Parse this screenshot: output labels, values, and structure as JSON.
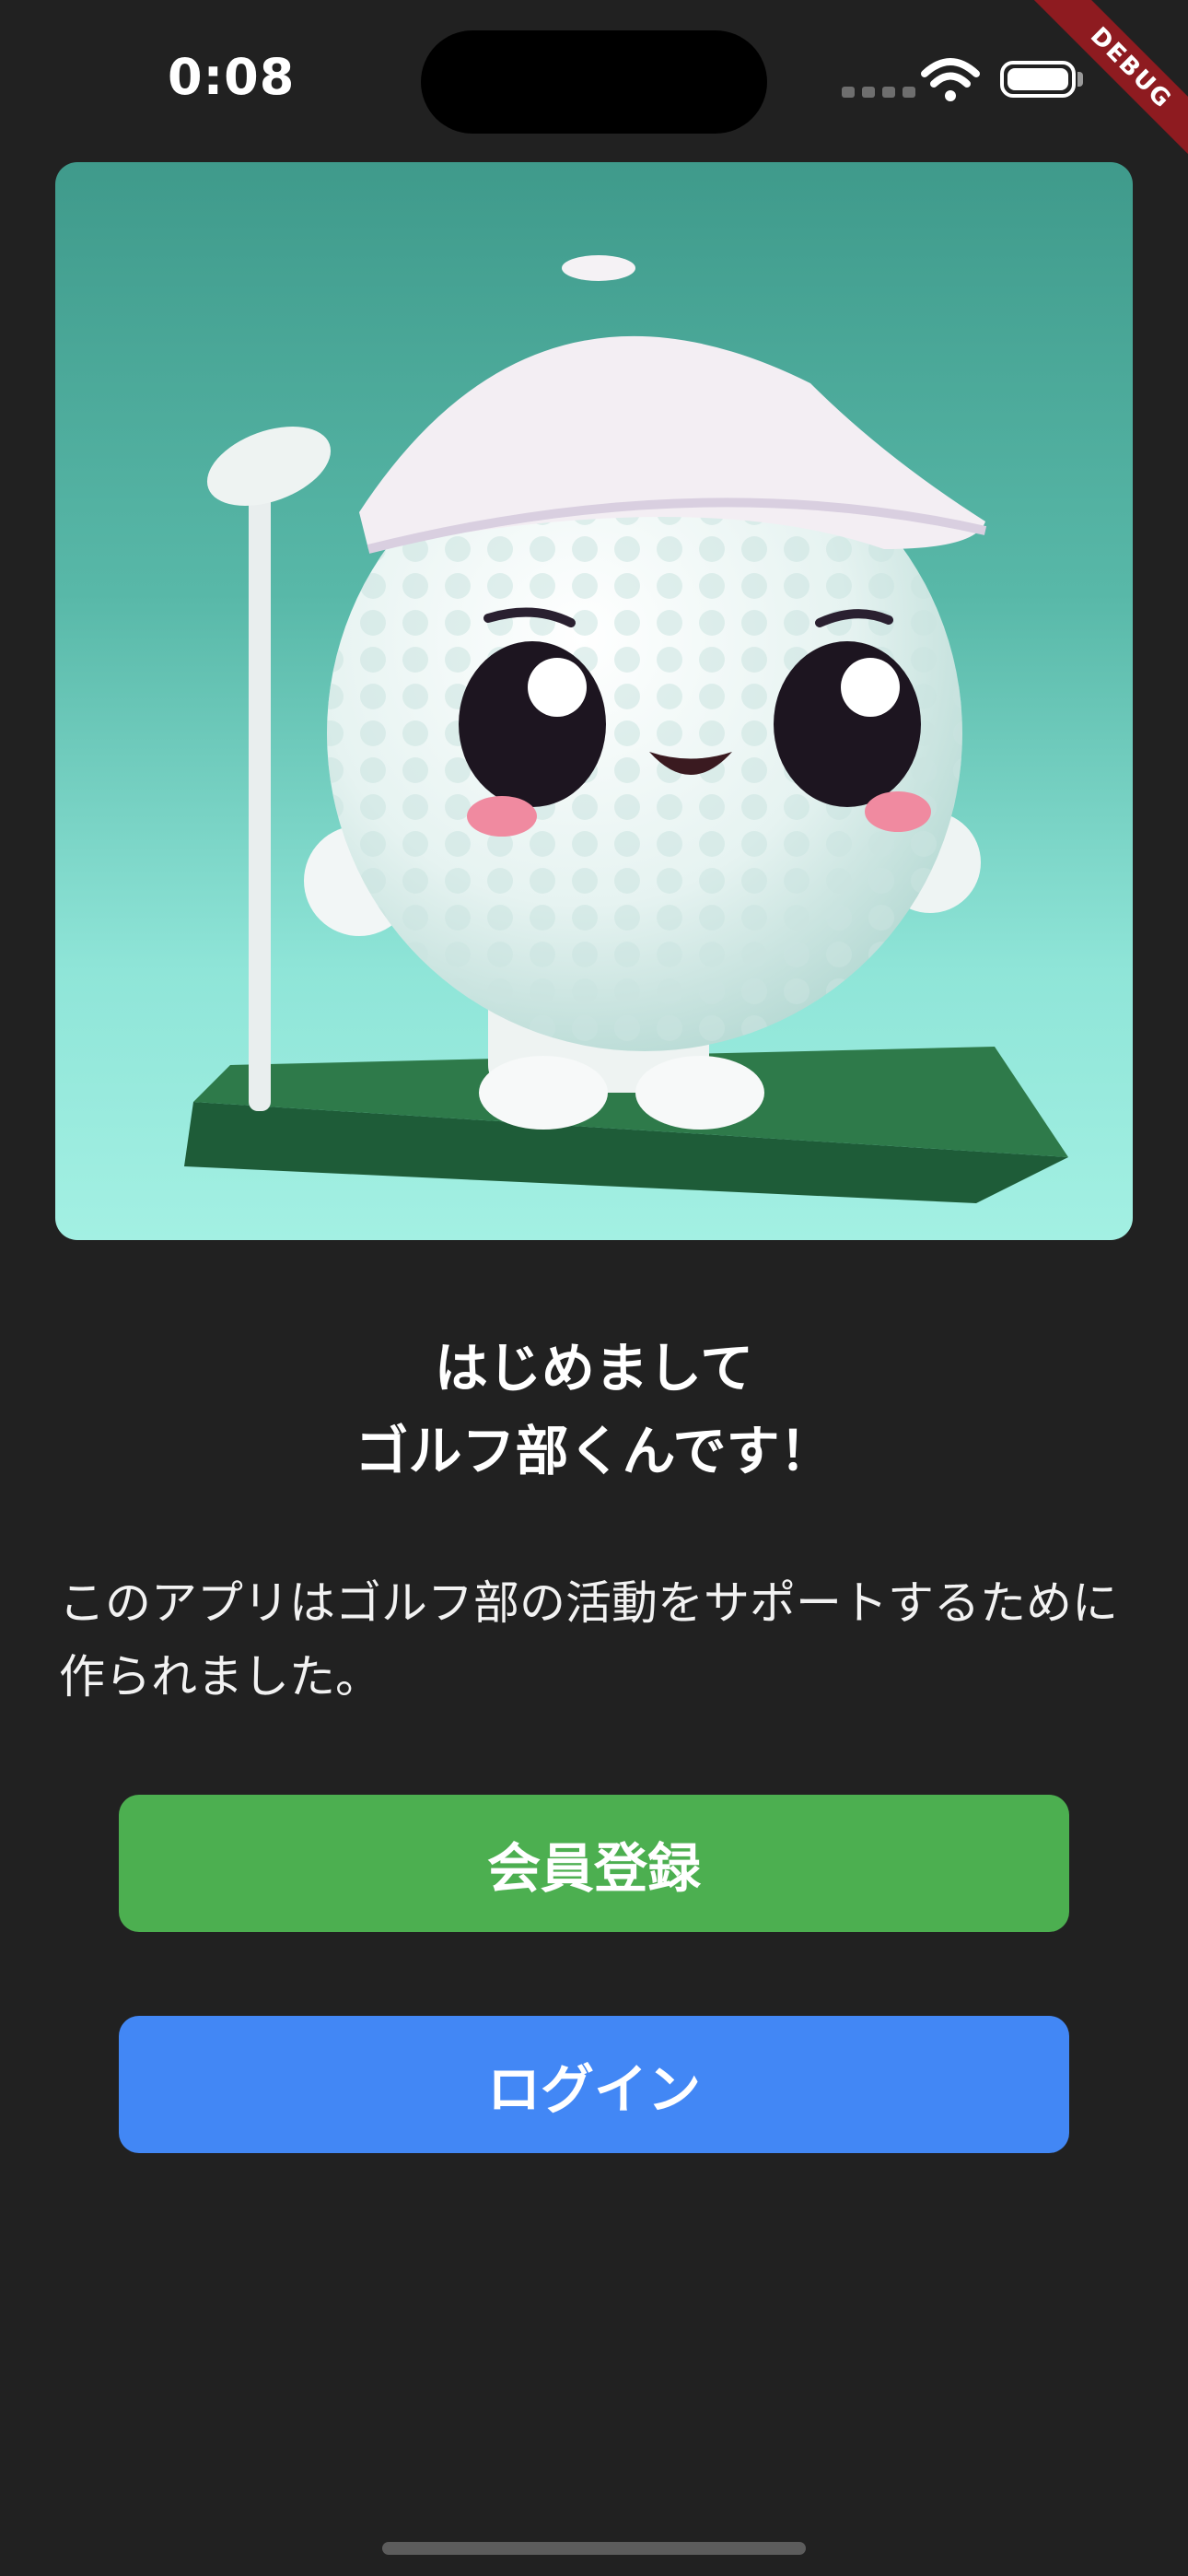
{
  "status_bar": {
    "time": "0:08",
    "debug_label": "DEBUG",
    "icons": [
      "cellular-signal-icon",
      "wifi-icon",
      "battery-icon"
    ]
  },
  "hero": {
    "image": "golf-ball-mascot-illustration"
  },
  "welcome": {
    "line1": "はじめまして",
    "line2": "ゴルフ部くんです！",
    "description": "このアプリはゴルフ部の活動をサポートするために作られました。"
  },
  "actions": {
    "register_label": "会員登録",
    "login_label": "ログイン"
  },
  "colors": {
    "background": "#212121",
    "register": "#4caf50",
    "login": "#4287f5",
    "debug": "#8e1b20"
  }
}
